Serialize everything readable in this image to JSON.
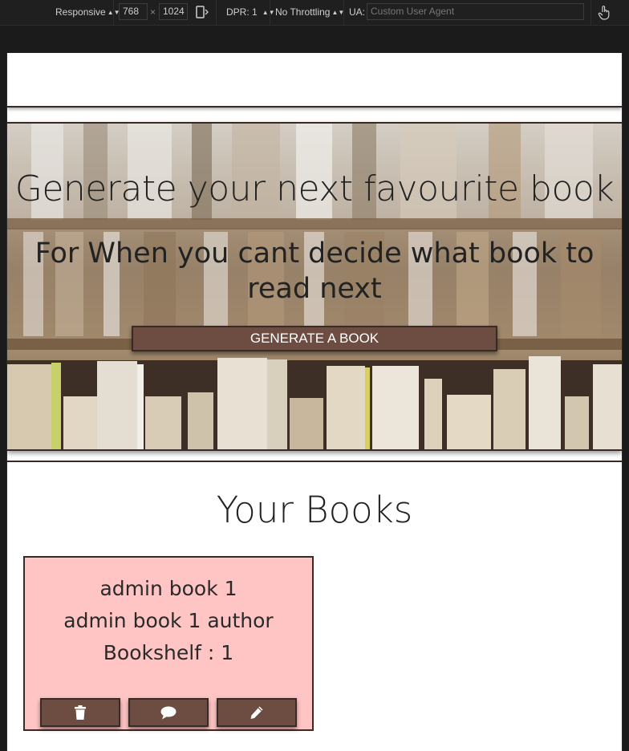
{
  "devtools": {
    "device": "Responsive",
    "width": "768",
    "times": "×",
    "height": "1024",
    "dpr": "DPR: 1",
    "throttling": "No Throttling",
    "ua_label": "UA:",
    "ua_placeholder": "Custom User Agent",
    "icons": [
      "rotate-icon",
      "touch-icon"
    ]
  },
  "hero": {
    "title": "Generate your next favourite book",
    "subtitle": "For When you cant decide what book to read next",
    "button_label": "GENERATE A BOOK"
  },
  "books_section": {
    "title": "Your Books",
    "books": [
      {
        "title": "admin book 1",
        "author": "admin book 1 author",
        "bookshelf": "Bookshelf : 1",
        "actions": [
          "trash-icon",
          "comment-icon",
          "pencil-icon"
        ]
      }
    ]
  },
  "colors": {
    "accent": "#6d4c41",
    "border": "#3a2a25",
    "card": "#ffc4c4"
  }
}
